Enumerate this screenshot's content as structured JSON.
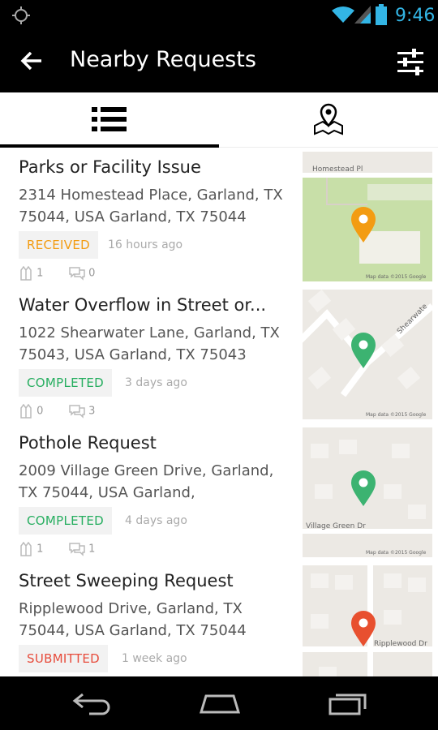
{
  "status": {
    "time": "9:46"
  },
  "app_bar": {
    "title": "Nearby Requests"
  },
  "tabs": [
    {
      "name": "list"
    },
    {
      "name": "map"
    }
  ],
  "items": [
    {
      "title": "Parks or Facility Issue",
      "address": "2314 Homestead Place, Garland, TX 75044, USA Garland, TX 75044",
      "status": "RECEIVED",
      "status_color": "#f39c12",
      "ago": "16 hours ago",
      "supports": "1",
      "comments": "0",
      "map_label": "Homestead Pl",
      "map_credit": "Map data ©2015 Google",
      "pin_color": "#f39c12"
    },
    {
      "title": "Water Overflow in Street or...",
      "address": "1022 Shearwater Lane, Garland, TX 75043, USA Garland, TX 75043",
      "status": "COMPLETED",
      "status_color": "#27ae60",
      "ago": "3 days ago",
      "supports": "0",
      "comments": "3",
      "map_label": "Shearwate",
      "map_credit": "Map data ©2015 Google",
      "pin_color": "#3cb371"
    },
    {
      "title": "Pothole Request",
      "address": "2009 Village Green Drive, Garland, TX 75044, USA Garland,",
      "status": "COMPLETED",
      "status_color": "#27ae60",
      "ago": "4 days ago",
      "supports": "1",
      "comments": "1",
      "map_label": "Village Green Dr",
      "map_credit": "Map data ©2015 Google",
      "pin_color": "#3cb371"
    },
    {
      "title": "Street Sweeping Request",
      "address": "Ripplewood Drive, Garland, TX 75044, USA Garland, TX 75044",
      "status": "SUBMITTED",
      "status_color": "#e74c3c",
      "ago": "1 week ago",
      "supports": "",
      "comments": "",
      "map_label": "Ripplewood Dr",
      "map_credit": "",
      "pin_color": "#e8502f"
    }
  ]
}
